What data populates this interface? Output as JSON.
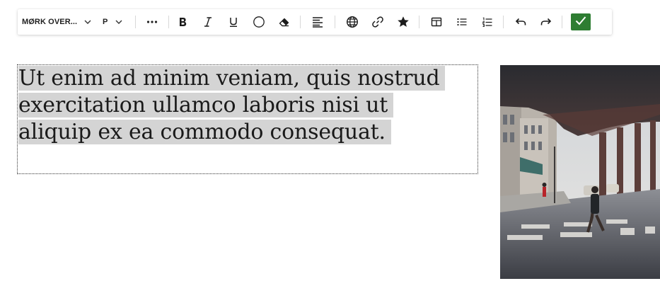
{
  "toolbar": {
    "style_dropdown": {
      "label": "MØRK OVER...",
      "icon": "chevron-down-icon"
    },
    "paragraph_dropdown": {
      "label": "P",
      "icon": "chevron-down-icon"
    },
    "buttons": [
      {
        "name": "more-options",
        "icon": "more-horizontal-icon"
      },
      {
        "name": "bold",
        "icon": "bold-icon"
      },
      {
        "name": "italic",
        "icon": "italic-icon"
      },
      {
        "name": "underline",
        "icon": "underline-icon"
      },
      {
        "name": "circle",
        "icon": "circle-icon"
      },
      {
        "name": "clear-formatting",
        "icon": "eraser-icon"
      },
      {
        "name": "align",
        "icon": "align-left-icon"
      },
      {
        "name": "web-link",
        "icon": "globe-icon"
      },
      {
        "name": "link",
        "icon": "link-icon"
      },
      {
        "name": "favorite",
        "icon": "star-icon"
      },
      {
        "name": "table",
        "icon": "table-icon"
      },
      {
        "name": "bulleted-list",
        "icon": "bulleted-list-icon"
      },
      {
        "name": "numbered-list",
        "icon": "numbered-list-icon"
      },
      {
        "name": "undo",
        "icon": "undo-icon"
      },
      {
        "name": "redo",
        "icon": "redo-icon"
      }
    ],
    "confirm": {
      "icon": "check-icon",
      "color": "#2e7d32"
    }
  },
  "editor": {
    "text": "Ut enim ad minim veniam, quis nostrud exercitation ullamco laboris nisi ut aliquip ex ea commodo consequat.",
    "selected": true,
    "selection_color": "#d4d4d4"
  },
  "image": {
    "subject": "street-photo"
  }
}
